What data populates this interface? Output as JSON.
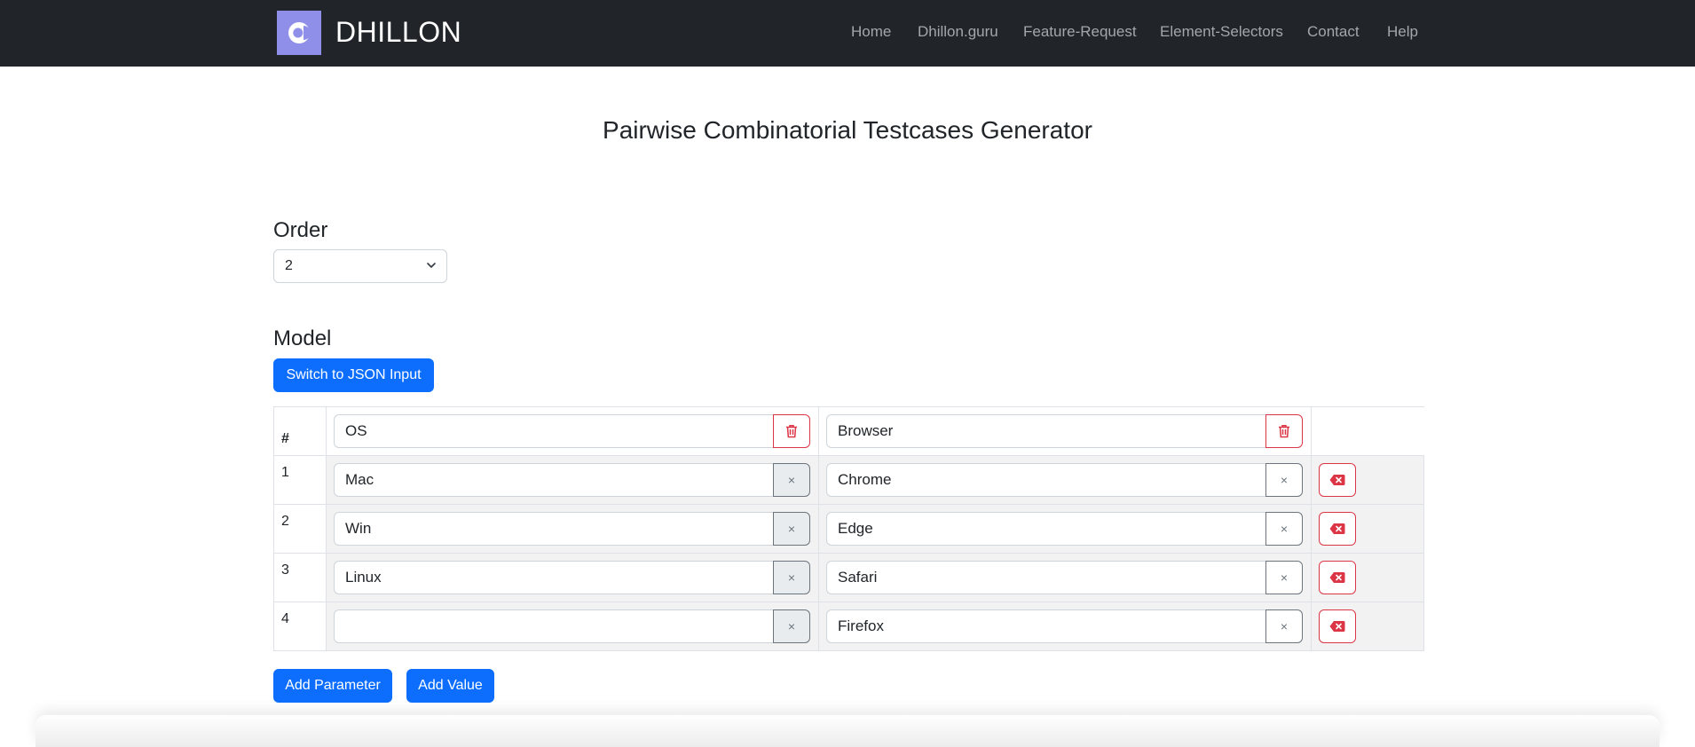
{
  "navbar": {
    "brand": "DHILLON",
    "links": [
      "Home",
      "Dhillon.guru",
      "Feature-Request",
      "Element-Selectors",
      "Contact",
      "Help"
    ]
  },
  "page_title": "Pairwise Combinatorial Testcases Generator",
  "order": {
    "label": "Order",
    "selected": "2"
  },
  "model": {
    "label": "Model",
    "switch_button": "Switch to JSON Input",
    "header_symbol": "#",
    "parameters": [
      "OS",
      "Browser"
    ],
    "rows": [
      {
        "num": "1",
        "values": [
          "Mac",
          "Chrome"
        ]
      },
      {
        "num": "2",
        "values": [
          "Win",
          "Edge"
        ]
      },
      {
        "num": "3",
        "values": [
          "Linux",
          "Safari"
        ]
      },
      {
        "num": "4",
        "values": [
          "",
          "Firefox"
        ]
      }
    ],
    "clear_symbol": "×",
    "add_parameter": "Add Parameter",
    "add_value": "Add Value"
  },
  "colors": {
    "navbar_bg": "#212529",
    "primary": "#0d6efd",
    "danger": "#dc3545",
    "logo_bg": "#8f8ee8"
  }
}
